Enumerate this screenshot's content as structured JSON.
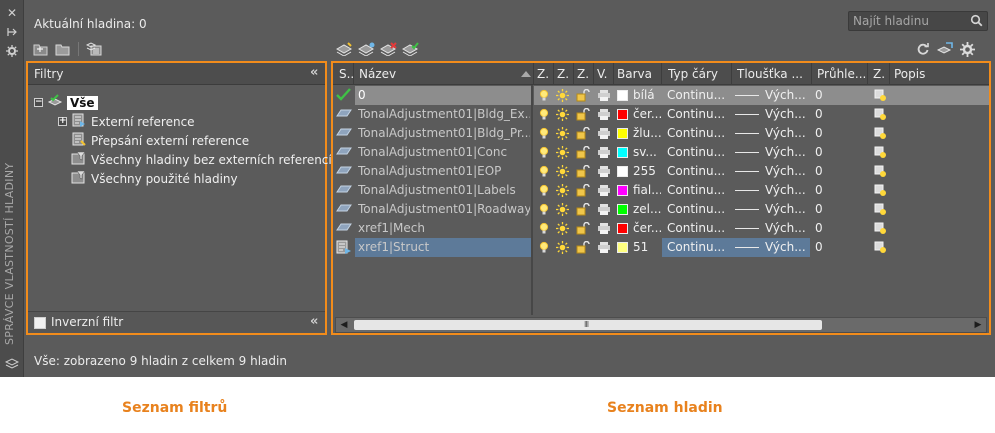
{
  "current_layer_label": "Aktuální hladina: 0",
  "search": {
    "placeholder": "Najít hladinu"
  },
  "side_title": "SPRÁVCE VLASTNOSTÍ HLADINY",
  "filters_panel": {
    "title": "Filtry",
    "tree": [
      {
        "label": "Vše",
        "level": 0,
        "selected": true
      },
      {
        "label": "Externí reference",
        "level": 1
      },
      {
        "label": "Přepsání externí reference",
        "level": 1
      },
      {
        "label": "Všechny hladiny bez externích referencí",
        "level": 1
      },
      {
        "label": "Všechny použité hladiny",
        "level": 1
      }
    ],
    "invert_label": "Inverzní filtr"
  },
  "layers_table": {
    "columns": [
      "S..",
      "Název",
      "Z.",
      "Z.",
      "Z.",
      "V.",
      "Barva",
      "Typ čáry",
      "Tloušťka ...",
      "Průhle...",
      "Z.",
      "Popis"
    ],
    "rows": [
      {
        "name": "0",
        "color_name": "bílá",
        "color": "#ffffff",
        "linetype": "Continu...",
        "lineweight": "Vých...",
        "transparency": "0",
        "current": true
      },
      {
        "name": "TonalAdjustment01|Bldg_Ex...",
        "color_name": "čer...",
        "color": "#ff0000",
        "linetype": "Continu...",
        "lineweight": "Vých...",
        "transparency": "0"
      },
      {
        "name": "TonalAdjustment01|Bldg_Pr...",
        "color_name": "žlu...",
        "color": "#ffff00",
        "linetype": "Continu...",
        "lineweight": "Vých...",
        "transparency": "0"
      },
      {
        "name": "TonalAdjustment01|Conc",
        "color_name": "sv...",
        "color": "#00ffff",
        "linetype": "Continu...",
        "lineweight": "Vých...",
        "transparency": "0"
      },
      {
        "name": "TonalAdjustment01|EOP",
        "color_name": "255",
        "color": "#ffffff",
        "linetype": "Continu...",
        "lineweight": "Vých...",
        "transparency": "0"
      },
      {
        "name": "TonalAdjustment01|Labels",
        "color_name": "fial...",
        "color": "#ff00ff",
        "linetype": "Continu...",
        "lineweight": "Vých...",
        "transparency": "0"
      },
      {
        "name": "TonalAdjustment01|Roadway",
        "color_name": "zel...",
        "color": "#00ff00",
        "linetype": "Continu...",
        "lineweight": "Vých...",
        "transparency": "0"
      },
      {
        "name": "xref1|Mech",
        "color_name": "čer...",
        "color": "#ff0000",
        "linetype": "Continu...",
        "lineweight": "Vých...",
        "transparency": "0"
      },
      {
        "name": "xref1|Struct",
        "color_name": "51",
        "color": "#ffff80",
        "linetype": "Continu...",
        "lineweight": "Vých...",
        "transparency": "0",
        "selected": true
      }
    ],
    "scroll_grip": "III"
  },
  "status_text": "Vše: zobrazeno 9 hladin z celkem 9 hladin",
  "captions": {
    "filters": "Seznam filtrů",
    "layers": "Seznam hladin"
  },
  "colors": {
    "panel_outline": "#f28c1b",
    "caption": "#e8821e",
    "selection": "#5d7a99",
    "background": "#5b5b5b"
  }
}
